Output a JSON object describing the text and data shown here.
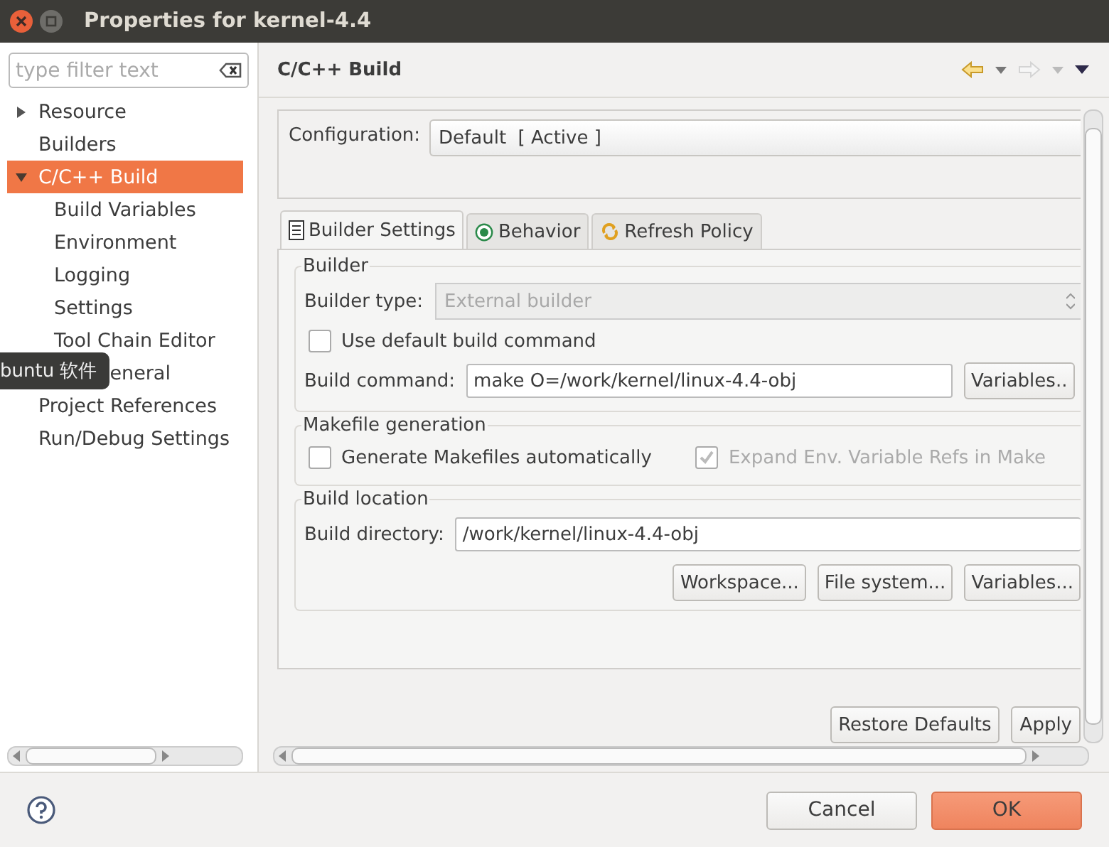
{
  "window": {
    "title": "Properties for kernel-4.4"
  },
  "filter": {
    "placeholder": "type filter text"
  },
  "tree": [
    {
      "label": "Resource",
      "expanded": false,
      "selected": false
    },
    {
      "label": "Builders",
      "selected": false
    },
    {
      "label": "C/C++ Build",
      "expanded": true,
      "selected": true,
      "children": [
        {
          "label": "Build Variables",
          "selected": false
        },
        {
          "label": "Environment",
          "selected": false
        },
        {
          "label": "Logging",
          "selected": false
        },
        {
          "label": "Settings",
          "selected": false
        },
        {
          "label": "Tool Chain Editor",
          "selected": false
        }
      ]
    },
    {
      "label": "eneral",
      "selected": false,
      "tooltip": "buntu 软件"
    },
    {
      "label": "Project References",
      "selected": false
    },
    {
      "label": "Run/Debug Settings",
      "selected": false
    }
  ],
  "page": {
    "title": "C/C++ Build"
  },
  "configuration": {
    "label": "Configuration:",
    "value": "Default  [ Active ]"
  },
  "tabs": [
    {
      "label": "Builder Settings",
      "kind": "list",
      "selected": true
    },
    {
      "label": "Behavior",
      "kind": "radio",
      "selected": false
    },
    {
      "label": "Refresh Policy",
      "kind": "refresh",
      "selected": false
    }
  ],
  "builder": {
    "title": "Builder",
    "type_label": "Builder type:",
    "type_value": "External builder",
    "type_disabled": true,
    "use_default": {
      "label": "Use default build command",
      "checked": false
    },
    "command_label": "Build command:",
    "command_value": "make O=/work/kernel/linux-4.4-obj",
    "variables_button": "Variables.."
  },
  "makefile": {
    "title": "Makefile generation",
    "options": [
      {
        "label": "Generate Makefiles automatically",
        "checked": false,
        "disabled": false
      },
      {
        "label": "Expand Env. Variable Refs in Make",
        "checked": true,
        "disabled": true
      }
    ]
  },
  "location": {
    "title": "Build location",
    "dir_label": "Build directory:",
    "dir_value": "/work/kernel/linux-4.4-obj",
    "buttons": [
      "Workspace...",
      "File system...",
      "Variables..."
    ]
  },
  "page_buttons": [
    "Restore Defaults",
    "Apply"
  ],
  "dialog_buttons": [
    {
      "label": "Cancel",
      "kind": "default"
    },
    {
      "label": "OK",
      "kind": "primary"
    }
  ]
}
